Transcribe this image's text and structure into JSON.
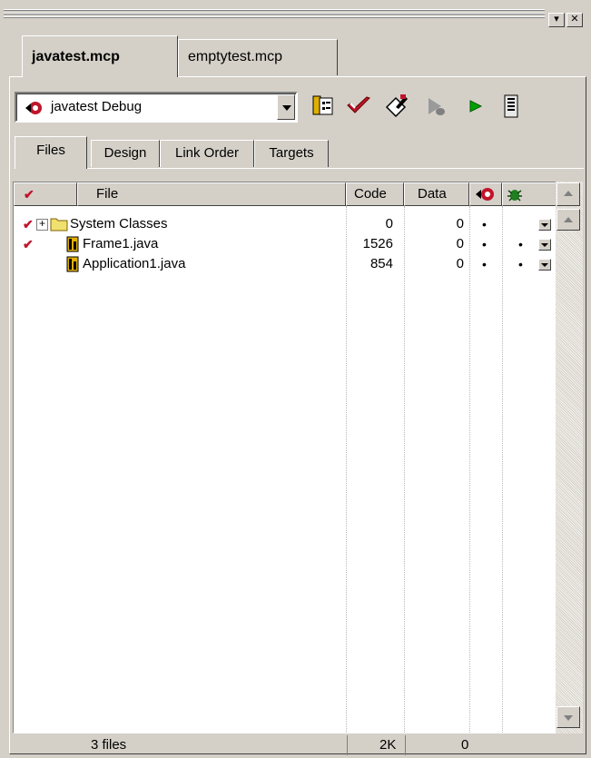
{
  "window": {
    "minimize_glyph": "▾",
    "close_glyph": "✕"
  },
  "doc_tabs": [
    {
      "label": "javatest.mcp",
      "active": true
    },
    {
      "label": "emptytest.mcp",
      "active": false
    }
  ],
  "target": {
    "selected": "javatest Debug",
    "icon": "target-red-icon"
  },
  "toolbar": {
    "icons": [
      "target-settings-icon",
      "check-syntax-icon",
      "make-icon",
      "debug-icon",
      "run-icon",
      "project-inspector-icon"
    ]
  },
  "view_tabs": [
    {
      "label": "Files",
      "active": true
    },
    {
      "label": "Design",
      "active": false
    },
    {
      "label": "Link Order",
      "active": false
    },
    {
      "label": "Targets",
      "active": false
    }
  ],
  "columns": {
    "check": "check-icon",
    "file": "File",
    "code": "Code",
    "data": "Data",
    "target_icon": "target-icon",
    "debug_icon": "bug-icon"
  },
  "rows": [
    {
      "checked": true,
      "expander": "⊞",
      "icon": "folder-icon",
      "name": "System Classes",
      "code": "0",
      "data": "0",
      "target_dot": "•",
      "debug_dot": ""
    },
    {
      "checked": true,
      "expander": "",
      "icon": "java-file-icon",
      "name": "Frame1.java",
      "code": "1526",
      "data": "0",
      "target_dot": "•",
      "debug_dot": "•"
    },
    {
      "checked": false,
      "expander": "",
      "icon": "java-file-icon",
      "name": "Application1.java",
      "code": "854",
      "data": "0",
      "target_dot": "•",
      "debug_dot": "•"
    }
  ],
  "status": {
    "files": "3 files",
    "code_total": "2K",
    "data_total": "0"
  },
  "colors": {
    "face": "#d4d0c8",
    "check_red": "#c0152a",
    "run_green": "#00a000"
  }
}
